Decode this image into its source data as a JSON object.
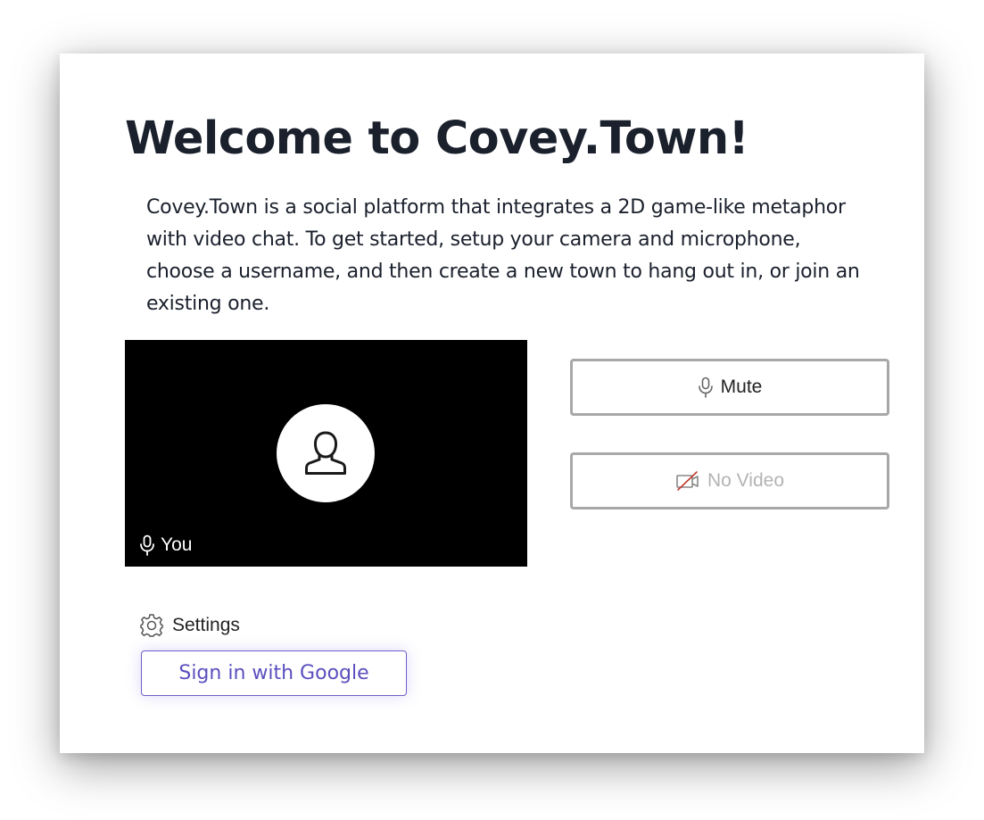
{
  "page": {
    "title": "Welcome to Covey.Town!",
    "intro": "Covey.Town is a social platform that integrates a 2D game-like metaphor with video chat. To get started, setup your camera and microphone, choose a username, and then create a new town to hang out in, or join an existing one."
  },
  "preview": {
    "participant_label": "You",
    "avatar_icon": "person-icon",
    "mic_icon": "microphone-icon",
    "background": "#000000"
  },
  "controls": {
    "mute_label": "Mute",
    "mute_icon": "microphone-icon",
    "video_label": "No Video",
    "video_icon": "video-off-icon",
    "video_disabled": true
  },
  "settings": {
    "label": "Settings",
    "icon": "gear-icon"
  },
  "auth": {
    "google_label": "Sign in with Google",
    "accent": "#5b4fbe"
  }
}
